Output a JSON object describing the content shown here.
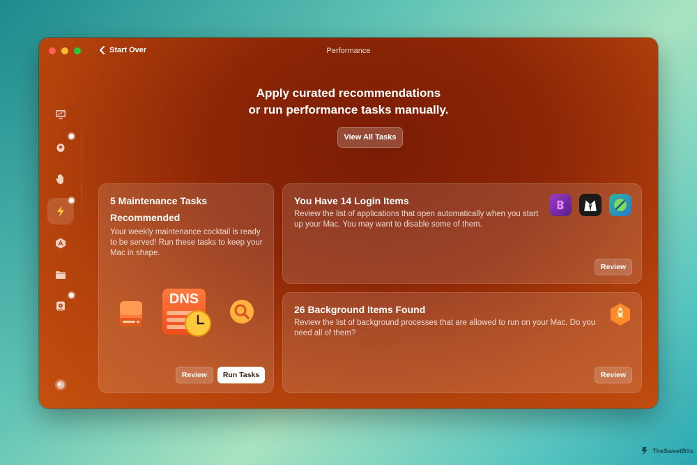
{
  "window": {
    "title": "Performance",
    "back_label": "Start Over"
  },
  "sidebar": {
    "items": [
      {
        "icon": "monitor-icon",
        "badge": false,
        "active": false
      },
      {
        "icon": "mouse-icon",
        "badge": true,
        "active": false
      },
      {
        "icon": "hand-icon",
        "badge": false,
        "active": false
      },
      {
        "icon": "lightning-icon",
        "badge": true,
        "active": true
      },
      {
        "icon": "app-store-icon",
        "badge": false,
        "active": false
      },
      {
        "icon": "folder-icon",
        "badge": false,
        "active": false
      },
      {
        "icon": "disk-icon",
        "badge": true,
        "active": false
      }
    ],
    "bottom_icon": "assistant-icon"
  },
  "hero": {
    "line1": "Apply curated recommendations",
    "line2": "or run performance tasks manually.",
    "button_label": "View All Tasks"
  },
  "maintenance": {
    "title_line1": "5 Maintenance Tasks",
    "title_line2": "Recommended",
    "description": "Your weekly maintenance cocktail is ready to be served! Run these tasks to keep your Mac in shape.",
    "dns_label": "DNS",
    "review_label": "Review",
    "run_label": "Run Tasks"
  },
  "login_items": {
    "title": "You Have 14 Login Items",
    "description": "Review the list of applications that open automatically when you start up your Mac. You may want to disable some of them.",
    "review_label": "Review",
    "apps": [
      "bbedit-icon",
      "bartender-icon",
      "cleanmymac-icon"
    ]
  },
  "background_items": {
    "title": "26 Background Items Found",
    "description": "Review the list of background processes that are allowed to run on your Mac. Do you need all of them?",
    "review_label": "Review",
    "icon": "rocket-badge-icon"
  },
  "watermark": "TheSweetBits"
}
